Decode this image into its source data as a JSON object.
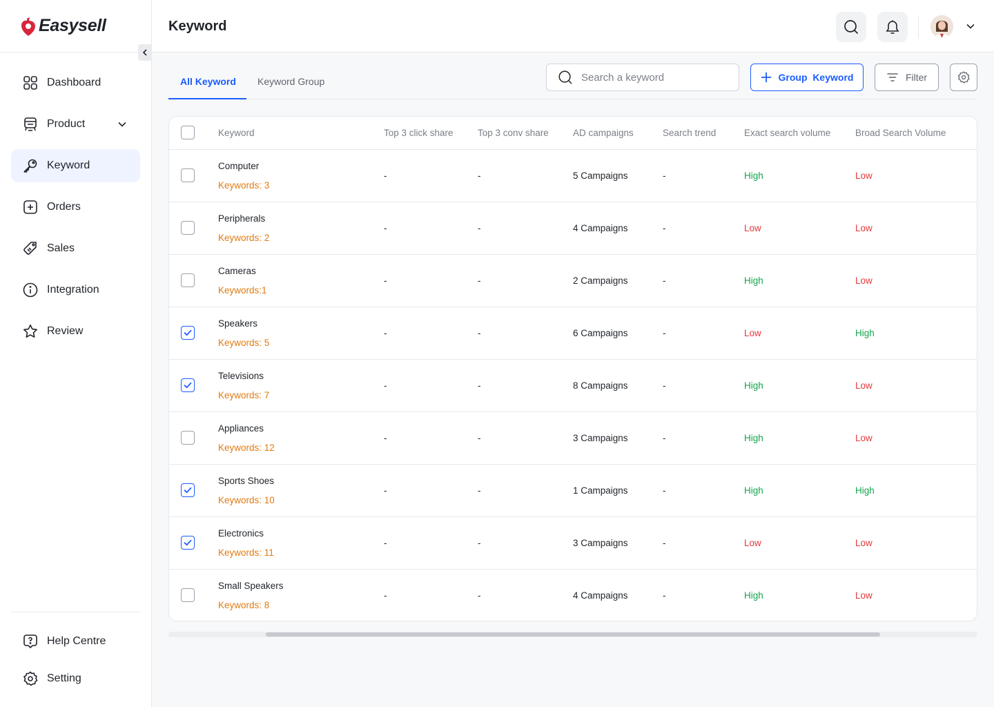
{
  "brand": {
    "name": "Easysell",
    "accent": "#1a5cff",
    "logo_color": "#d7263d"
  },
  "sidebar": {
    "items": [
      {
        "label": "Dashboard",
        "icon": "grid-icon",
        "active": false
      },
      {
        "label": "Product",
        "icon": "product-icon",
        "active": false,
        "expandable": true
      },
      {
        "label": "Keyword",
        "icon": "key-icon",
        "active": true
      },
      {
        "label": "Orders",
        "icon": "plus-square-icon",
        "active": false
      },
      {
        "label": "Sales",
        "icon": "tag-icon",
        "active": false
      },
      {
        "label": "Integration",
        "icon": "info-icon",
        "active": false
      },
      {
        "label": "Review",
        "icon": "star-icon",
        "active": false
      }
    ],
    "bottom": [
      {
        "label": "Help Centre",
        "icon": "help-icon"
      },
      {
        "label": "Setting",
        "icon": "gear-icon"
      }
    ]
  },
  "header": {
    "title": "Keyword"
  },
  "tabs": [
    {
      "label": "All Keyword",
      "active": true
    },
    {
      "label": "Keyword Group",
      "active": false
    }
  ],
  "toolbar": {
    "search_placeholder": "Search a keyword",
    "group_button": "Group  Keyword",
    "filter_button": "Filter"
  },
  "table": {
    "columns": [
      "Keyword",
      "Top 3 click share",
      "Top 3 conv share",
      "AD campaigns",
      "Search trend",
      "Exact search volume",
      "Broad Search Volume"
    ],
    "rows": [
      {
        "name": "Computer",
        "keywords": "Keywords: 3",
        "click": "-",
        "conv": "-",
        "campaigns": "5 Campaigns",
        "trend": "-",
        "exact": "High",
        "broad": "Low",
        "checked": false
      },
      {
        "name": "Peripherals",
        "keywords": "Keywords: 2",
        "click": "-",
        "conv": "-",
        "campaigns": "4 Campaigns",
        "trend": "-",
        "exact": "Low",
        "broad": "Low",
        "checked": false
      },
      {
        "name": "Cameras",
        "keywords": "Keywords:1",
        "click": "-",
        "conv": "-",
        "campaigns": "2 Campaigns",
        "trend": "-",
        "exact": "High",
        "broad": "Low",
        "checked": false
      },
      {
        "name": "Speakers",
        "keywords": "Keywords: 5",
        "click": "-",
        "conv": "-",
        "campaigns": "6 Campaigns",
        "trend": "-",
        "exact": "Low",
        "broad": "High",
        "checked": true
      },
      {
        "name": "Televisions",
        "keywords": "Keywords: 7",
        "click": "-",
        "conv": "-",
        "campaigns": "8 Campaigns",
        "trend": "-",
        "exact": "High",
        "broad": "Low",
        "checked": true
      },
      {
        "name": "Appliances",
        "keywords": "Keywords: 12",
        "click": "-",
        "conv": "-",
        "campaigns": "3 Campaigns",
        "trend": "-",
        "exact": "High",
        "broad": "Low",
        "checked": false
      },
      {
        "name": "Sports Shoes",
        "keywords": "Keywords: 10",
        "click": "-",
        "conv": "-",
        "campaigns": "1 Campaigns",
        "trend": "-",
        "exact": "High",
        "broad": "High",
        "checked": true
      },
      {
        "name": "Electronics",
        "keywords": "Keywords: 11",
        "click": "-",
        "conv": "-",
        "campaigns": "3 Campaigns",
        "trend": "-",
        "exact": "Low",
        "broad": "Low",
        "checked": true
      },
      {
        "name": "Small Speakers",
        "keywords": "Keywords: 8",
        "click": "-",
        "conv": "-",
        "campaigns": "4 Campaigns",
        "trend": "-",
        "exact": "High",
        "broad": "Low",
        "checked": false
      }
    ]
  },
  "colors": {
    "high": "#14a44d",
    "low": "#e5383b",
    "keyword_count": "#e07b12"
  }
}
